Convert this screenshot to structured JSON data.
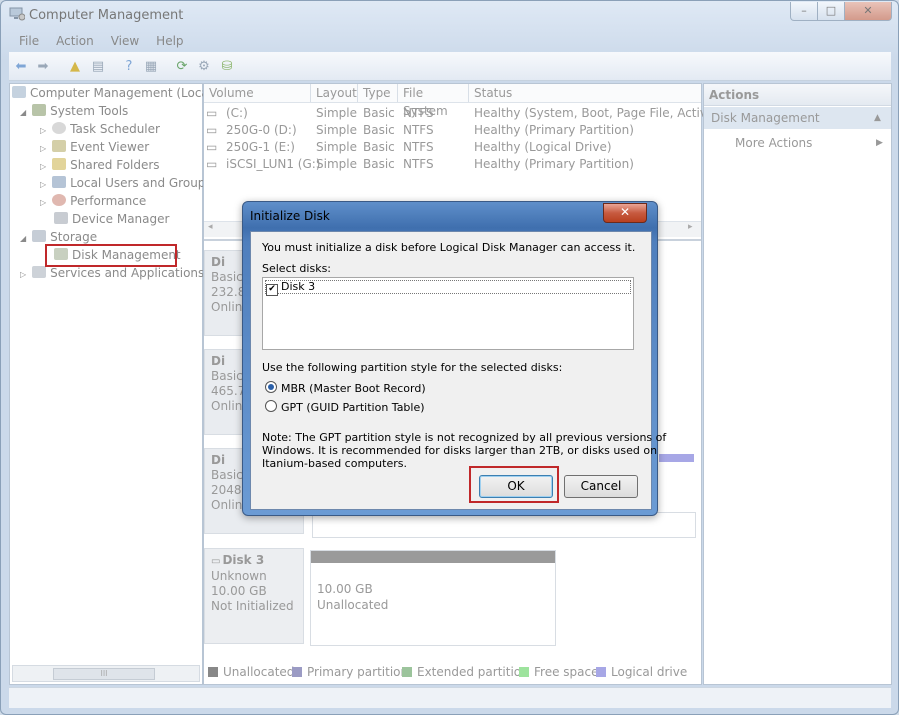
{
  "window": {
    "title": "Computer Management",
    "controls": [
      "–",
      "□",
      "✕"
    ]
  },
  "menu": [
    "File",
    "Action",
    "View",
    "Help"
  ],
  "tree": {
    "root": "Computer Management (Local",
    "system_tools": "System Tools",
    "task_scheduler": "Task Scheduler",
    "event_viewer": "Event Viewer",
    "shared_folders": "Shared Folders",
    "local_users": "Local Users and Groups",
    "performance": "Performance",
    "device_manager": "Device Manager",
    "storage": "Storage",
    "disk_management": "Disk Management",
    "services": "Services and Applications"
  },
  "volume_table": {
    "headers": [
      "Volume",
      "Layout",
      "Type",
      "File System",
      "Status"
    ],
    "rows": [
      [
        "(C:)",
        "Simple",
        "Basic",
        "NTFS",
        "Healthy (System, Boot, Page File, Active, C"
      ],
      [
        "250G-0 (D:)",
        "Simple",
        "Basic",
        "NTFS",
        "Healthy (Primary Partition)"
      ],
      [
        "250G-1 (E:)",
        "Simple",
        "Basic",
        "NTFS",
        "Healthy (Logical Drive)"
      ],
      [
        "iSCSI_LUN1 (G:)",
        "Simple",
        "Basic",
        "NTFS",
        "Healthy (Primary Partition)"
      ]
    ]
  },
  "disks": {
    "disk0": {
      "name": "Di",
      "type": "Basic",
      "size": "232.8",
      "state": "Onlin"
    },
    "disk1": {
      "name": "Di",
      "type": "Basic",
      "size": "465.7",
      "state": "Onlin"
    },
    "disk2": {
      "name": "Di",
      "type": "Basic",
      "size": "2048.0",
      "state": "Onlin"
    },
    "disk3": {
      "name": "Disk 3",
      "type": "Unknown",
      "size": "10.00 GB",
      "state": "Not Initialized",
      "part_size": "10.00 GB",
      "part_label": "Unallocated"
    }
  },
  "legend": [
    {
      "label": "Unallocated",
      "color": "#888888"
    },
    {
      "label": "Primary partition",
      "color": "#9b9bc4"
    },
    {
      "label": "Extended partition",
      "color": "#9cc49c"
    },
    {
      "label": "Free space",
      "color": "#9de39d"
    },
    {
      "label": "Logical drive",
      "color": "#a7a7e6"
    }
  ],
  "actions": {
    "header": "Actions",
    "section": "Disk Management",
    "more": "More Actions"
  },
  "hscroll_label": "III",
  "dialog": {
    "title": "Initialize Disk",
    "close": "✕",
    "intro": "You must initialize a disk before Logical Disk Manager can access it.",
    "select_label": "Select disks:",
    "disks": [
      {
        "label": "Disk 3",
        "checked": true
      }
    ],
    "style_label": "Use the following partition style for the selected disks:",
    "mbr": "MBR (Master Boot Record)",
    "gpt": "GPT (GUID Partition Table)",
    "selected_style": "MBR",
    "note1": "Note: The GPT partition style is not recognized by all previous versions of",
    "note2": "Windows. It is recommended for disks larger than 2TB, or disks used on",
    "note3": "Itanium-based computers.",
    "ok": "OK",
    "cancel": "Cancel"
  }
}
